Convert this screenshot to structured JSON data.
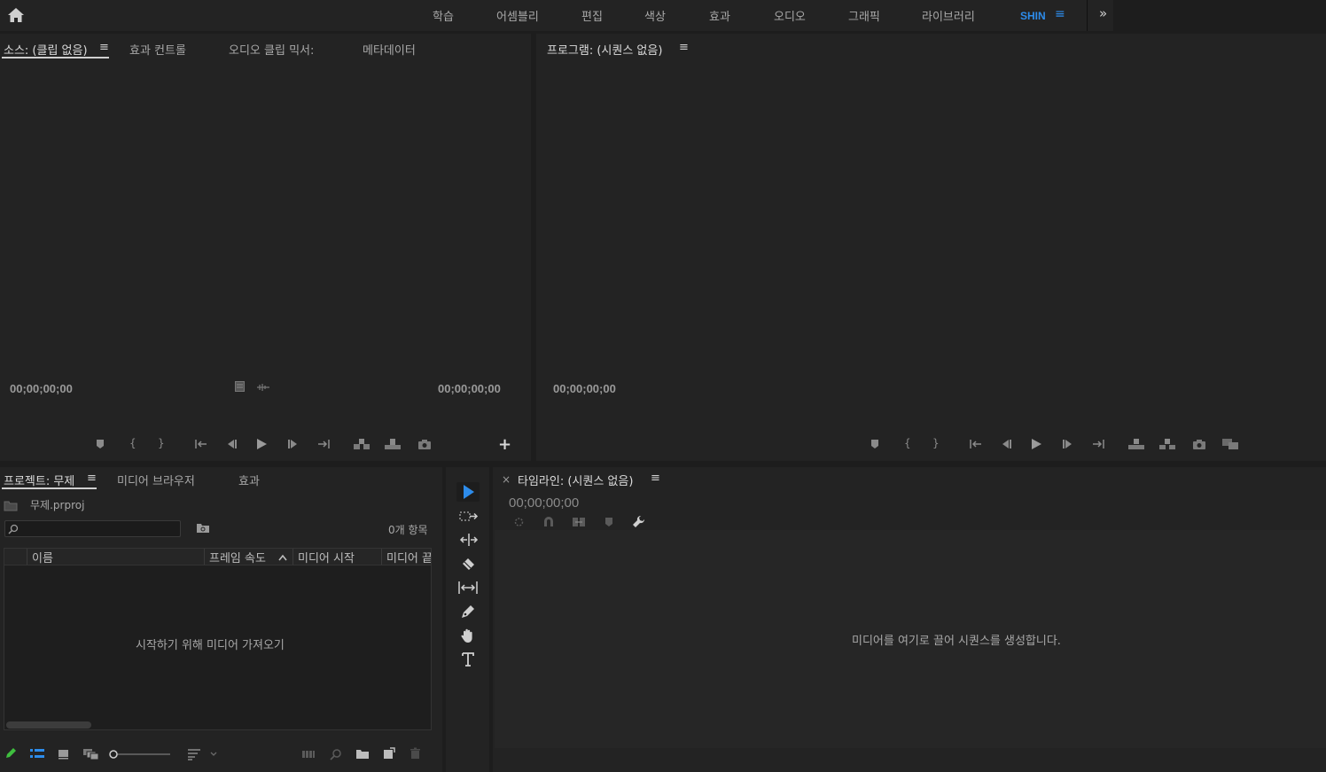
{
  "workspaces": {
    "items": [
      "학습",
      "어셈블리",
      "편집",
      "색상",
      "효과",
      "오디오",
      "그래픽",
      "라이브러리"
    ],
    "active": "SHIN"
  },
  "source_panel": {
    "tabs": [
      "소스: (클립 없음)",
      "효과 컨트롤",
      "오디오 클립 믹서:",
      "메타데이터"
    ],
    "timecode_left": "00;00;00;00",
    "timecode_right": "00;00;00;00"
  },
  "program_panel": {
    "tab": "프로그램: (시퀀스 없음)",
    "timecode": "00;00;00;00"
  },
  "project_panel": {
    "tabs": [
      "프로젝트: 무제",
      "미디어 브라우저",
      "효과"
    ],
    "file_name": "무제.prproj",
    "search_placeholder": "",
    "item_count": "0개 항목",
    "columns": [
      "이름",
      "프레임 속도",
      "미디어 시작",
      "미디어 끝"
    ],
    "empty_message": "시작하기 위해 미디어 가져오기"
  },
  "timeline_panel": {
    "close": "×",
    "tab": "타임라인: (시퀀스 없음)",
    "timecode": "00;00;00;00",
    "empty_message": "미디어를 여기로 끌어 시퀀스를 생성합니다."
  },
  "icons": {
    "home": "home-icon",
    "panel_menu": "≡",
    "more": "»",
    "add": "+"
  },
  "colors": {
    "accent": "#2d8ceb",
    "panel_bg": "#232323",
    "app_bg": "#1d1d1d",
    "selection_tool": "#2d8ceb"
  }
}
